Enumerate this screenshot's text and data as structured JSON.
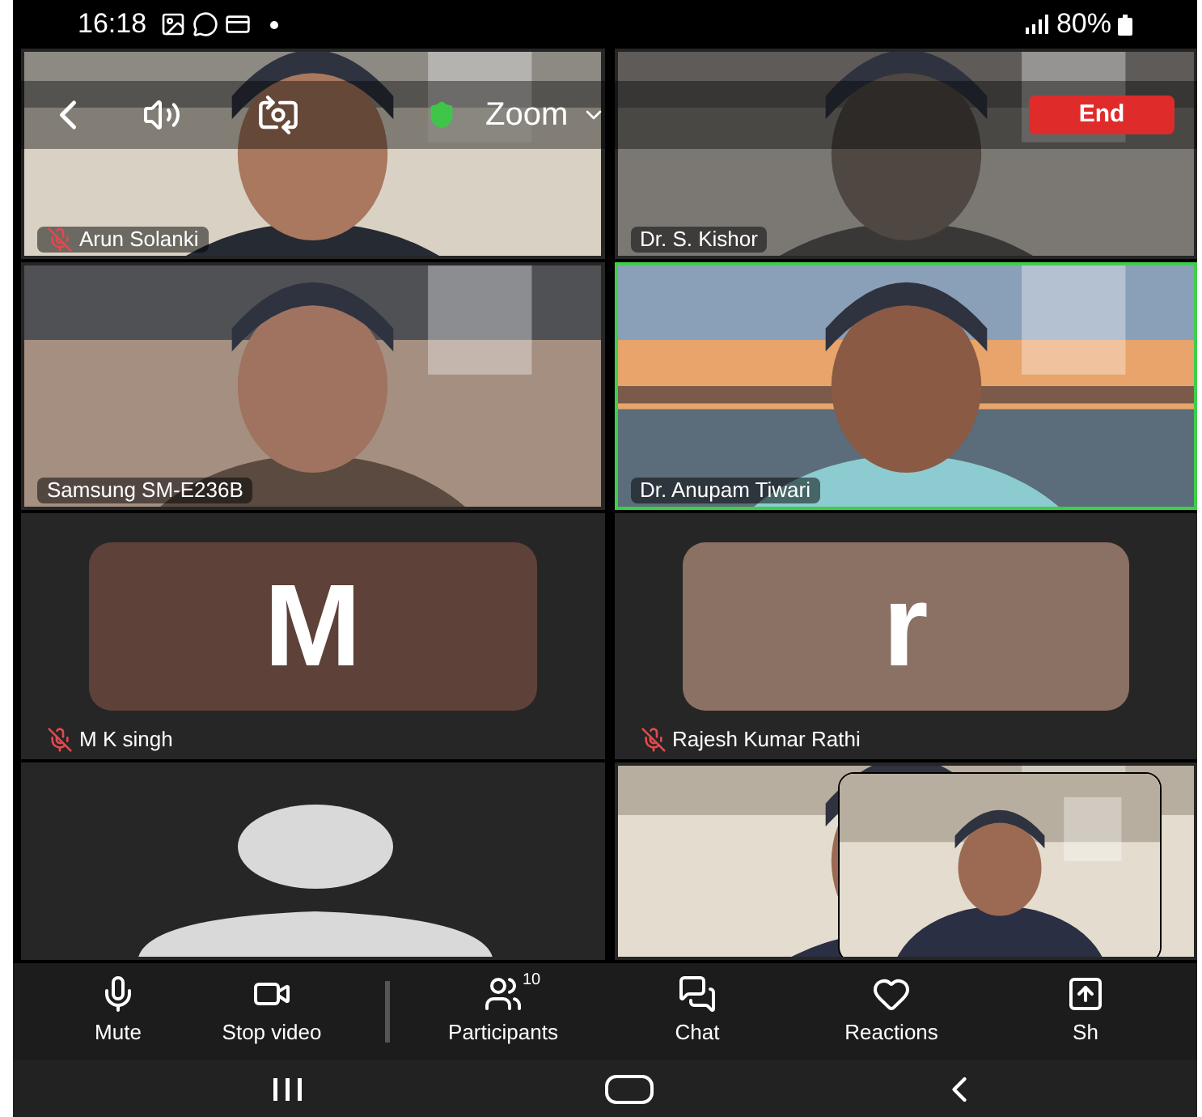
{
  "status_bar": {
    "time": "16:18",
    "battery": "80%"
  },
  "meeting_bar": {
    "title": "Zoom",
    "end_button": "End"
  },
  "tiles": [
    {
      "kind": "video",
      "name": "Arun Solanki",
      "muted": true,
      "active_speaker": false
    },
    {
      "kind": "video",
      "name": "Dr. S. Kishor",
      "muted": false,
      "active_speaker": false
    },
    {
      "kind": "video",
      "name": "Samsung SM-E236B",
      "muted": false,
      "active_speaker": false
    },
    {
      "kind": "video",
      "name": "Dr. Anupam Tiwari",
      "muted": false,
      "active_speaker": true
    },
    {
      "kind": "avatar",
      "letter": "M",
      "color": "#5e4138",
      "name": "M K singh",
      "muted": true,
      "active_speaker": false
    },
    {
      "kind": "avatar",
      "letter": "r",
      "color": "#8b7064",
      "name": "Rajesh Kumar Rathi",
      "muted": true,
      "active_speaker": false
    },
    {
      "kind": "silhouette",
      "active_speaker": false
    },
    {
      "kind": "video_self",
      "active_speaker": false
    }
  ],
  "toolbar": [
    {
      "kind": "mic",
      "label": "Mute"
    },
    {
      "kind": "video",
      "label": "Stop video"
    },
    {
      "kind": "participants",
      "label": "Participants",
      "badge": "10"
    },
    {
      "kind": "chat",
      "label": "Chat"
    },
    {
      "kind": "reactions",
      "label": "Reactions"
    },
    {
      "kind": "share",
      "label": "Sh"
    }
  ]
}
